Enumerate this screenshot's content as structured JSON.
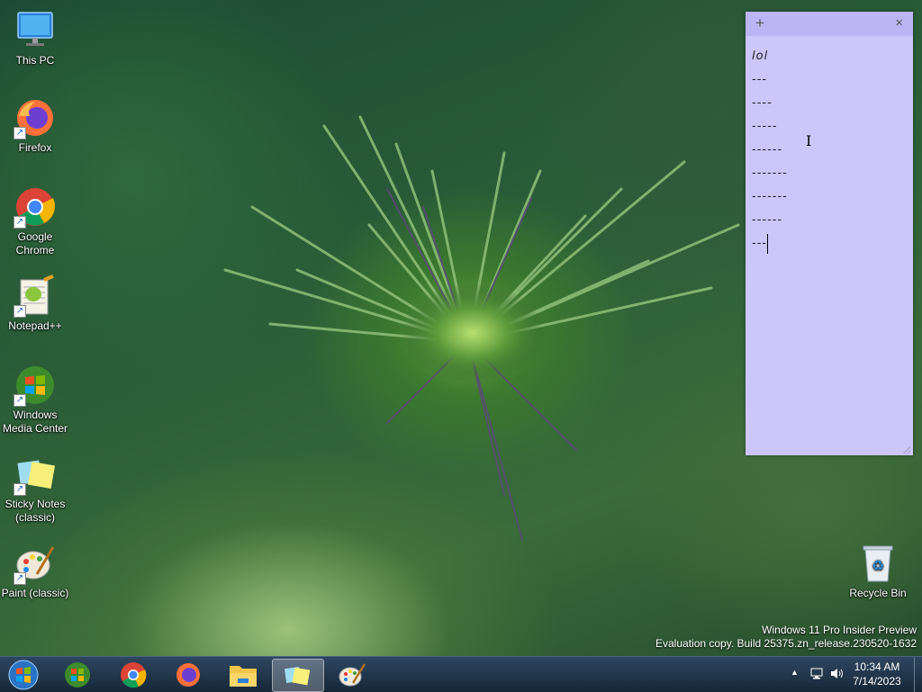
{
  "desktop_icons": [
    {
      "label": "This PC",
      "icon": "this-pc-icon"
    },
    {
      "label": "Firefox",
      "icon": "firefox-icon"
    },
    {
      "label": "Google Chrome",
      "icon": "chrome-icon"
    },
    {
      "label": "Notepad++",
      "icon": "notepadpp-icon"
    },
    {
      "label": "Windows Media Center",
      "icon": "media-center-icon"
    },
    {
      "label": "Sticky Notes (classic)",
      "icon": "sticky-notes-icon"
    },
    {
      "label": "Paint (classic)",
      "icon": "paint-icon"
    },
    {
      "label": "Recycle Bin",
      "icon": "recycle-bin-icon"
    }
  ],
  "sticky_note": {
    "add_glyph": "+",
    "close_glyph": "×",
    "lines": [
      "lol",
      "---",
      "----",
      "-----",
      "------",
      "-------",
      "-------",
      "------",
      "---"
    ],
    "color": "#cdc6fb"
  },
  "watermark": {
    "line1": "Windows 11 Pro Insider Preview",
    "line2": "Evaluation copy. Build 25375.zn_release.230520-1632"
  },
  "taskbar": {
    "apps": [
      "start-orb",
      "media-center",
      "chrome",
      "firefox",
      "file-explorer",
      "sticky-notes",
      "paint"
    ],
    "active_app": "sticky-notes",
    "tray_chevron": "▲",
    "time": "10:34 AM",
    "date": "7/14/2023"
  }
}
